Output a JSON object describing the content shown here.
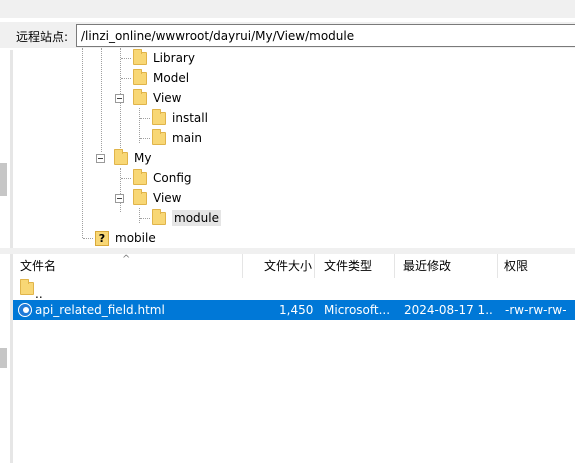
{
  "path_bar": {
    "label": "远程站点:",
    "value": "/linzi_online/wwwroot/dayrui/My/View/module"
  },
  "tree": [
    {
      "name": "Library",
      "indent": 2
    },
    {
      "name": "Model",
      "indent": 2
    },
    {
      "name": "View",
      "indent": 2,
      "expanded": true
    },
    {
      "name": "install",
      "indent": 3
    },
    {
      "name": "main",
      "indent": 3
    },
    {
      "name": "My",
      "indent": 1,
      "expanded": true
    },
    {
      "name": "Config",
      "indent": 2
    },
    {
      "name": "View",
      "indent": 2,
      "expanded": true
    },
    {
      "name": "module",
      "indent": 3,
      "selected": true
    },
    {
      "name": "mobile",
      "indent": 0,
      "unknown": true
    }
  ],
  "list": {
    "columns": [
      "文件名",
      "文件大小",
      "文件类型",
      "最近修改",
      "权限"
    ],
    "parent_entry": "..",
    "rows": [
      {
        "name": "api_related_field.html",
        "size": "1,450",
        "type": "Microsoft...",
        "modified": "2024-08-17 1...",
        "permissions": "-rw-rw-rw-",
        "selected": true
      }
    ]
  },
  "colors": {
    "selection": "#0078d7",
    "folder": "#f8d775"
  }
}
